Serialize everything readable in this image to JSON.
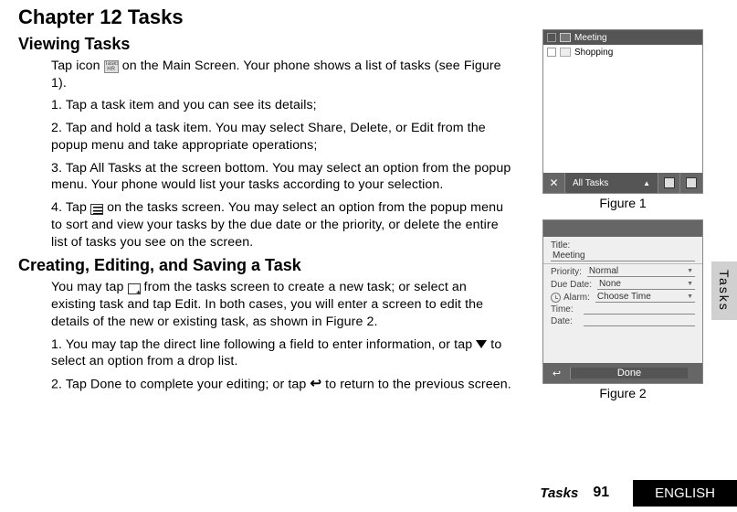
{
  "chapter_title": "Chapter 12 Tasks",
  "section_viewing": {
    "heading": "Viewing Tasks",
    "intro_before_icon": "Tap icon ",
    "intro_after_icon": " on the Main Screen. Your phone shows a list of tasks (see Figure 1).",
    "icon_sublabel": "Tasks",
    "steps": {
      "s1": "1. Tap a task item and you can see its details;",
      "s2": "2. Tap and hold a task item. You may select Share, Delete, or Edit from the popup menu and take appropriate operations;",
      "s3": "3. Tap All Tasks at the screen bottom. You may select an option from the popup menu. Your phone would list your tasks according to your selection.",
      "s4_pre": "4. Tap ",
      "s4_post": " on the tasks screen. You may select an option from the popup menu to sort and view your tasks by the due date or the priority, or delete the entire list of tasks you see on the screen."
    }
  },
  "section_creating": {
    "heading": "Creating, Editing, and Saving a Task",
    "p1_pre": "You may tap ",
    "p1_post": " from the tasks screen to create a new task; or select an existing task and tap Edit. In both cases, you will enter a screen to edit the details of the new or existing task, as shown in Figure 2.",
    "step1_pre": "1. You may tap the direct line following a field to enter information, or tap ",
    "step1_post": " to select an option from a drop list.",
    "step2_pre": "2.  Tap Done to complete your editing; or tap ",
    "step2_post": " to return to the previous screen."
  },
  "figure1": {
    "caption": "Figure 1",
    "row1_label": "Meeting",
    "row2_label": "Shopping",
    "bottom_label": "All Tasks",
    "close_glyph": "✕"
  },
  "figure2": {
    "caption": "Figure 2",
    "title_label": "Title:",
    "title_value": "Meeting",
    "priority_label": "Priority:",
    "priority_value": "Normal",
    "due_label": "Due Date:",
    "due_value": "None",
    "alarm_label": "Alarm:",
    "alarm_value": "Choose Time",
    "time_label": "Time:",
    "date_label": "Date:",
    "done_label": "Done",
    "back_glyph": "↩"
  },
  "side_tab": "Tasks",
  "footer": {
    "title": "Tasks",
    "page": "91",
    "language": "ENGLISH"
  }
}
